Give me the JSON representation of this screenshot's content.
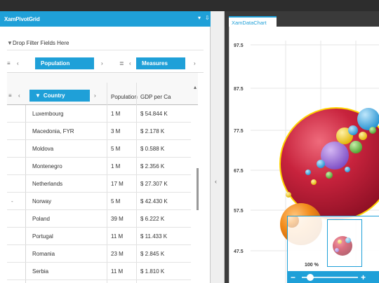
{
  "pivot": {
    "title": "XamPivotGrid",
    "drop_filter": "Drop Filter Fields Here",
    "row_chip": "Population",
    "measures_chip": "Measures",
    "country_chip": "Country",
    "columns": [
      "Population",
      "GDP per Ca"
    ],
    "rows": [
      {
        "country": "Luxembourg",
        "pop": "1 M",
        "gdp": "$ 54.844 K"
      },
      {
        "country": "Macedonia, FYR",
        "pop": "3 M",
        "gdp": "$ 2.178 K"
      },
      {
        "country": "Moldova",
        "pop": "5 M",
        "gdp": "$ 0.588 K"
      },
      {
        "country": "Montenegro",
        "pop": "1 M",
        "gdp": "$ 2.356 K"
      },
      {
        "country": "Netherlands",
        "pop": "17 M",
        "gdp": "$ 27.307 K"
      },
      {
        "country": "Norway",
        "pop": "5 M",
        "gdp": "$ 42.430 K"
      },
      {
        "country": "Poland",
        "pop": "39 M",
        "gdp": "$ 6.222 K"
      },
      {
        "country": "Portugal",
        "pop": "11 M",
        "gdp": "$ 11.433 K"
      },
      {
        "country": "Romania",
        "pop": "23 M",
        "gdp": "$ 2.845 K"
      },
      {
        "country": "Serbia",
        "pop": "11 M",
        "gdp": "$ 1.810 K"
      }
    ]
  },
  "chart": {
    "tab_label": "XamDataChart",
    "y_ticks": [
      "97.5",
      "87.5",
      "77.5",
      "67.5",
      "57.5",
      "47.5"
    ],
    "zoom_label": "100 %"
  },
  "colors": {
    "accent": "#1fa0d8",
    "bubble_red": "#c8233d",
    "bubble_orange": "#f28b1a"
  }
}
